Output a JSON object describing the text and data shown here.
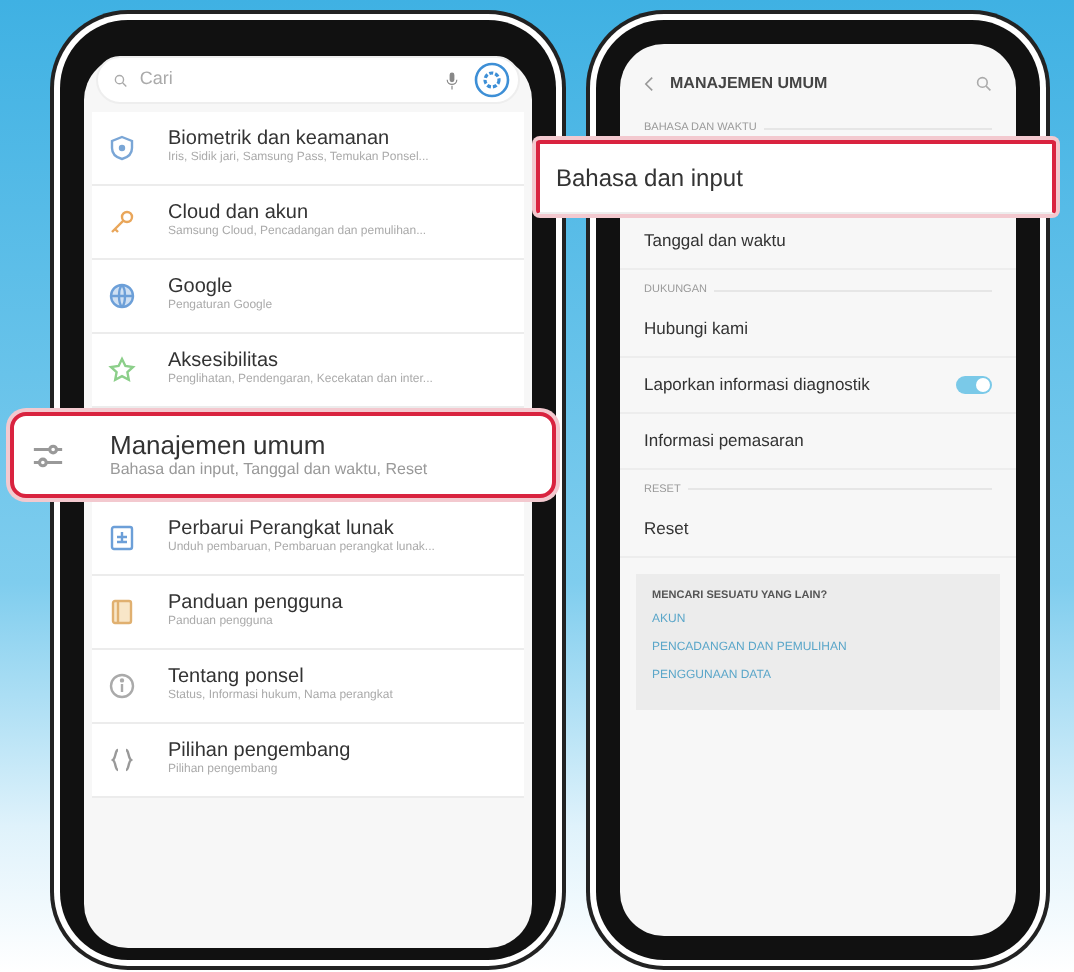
{
  "left_screen": {
    "search": {
      "placeholder": "Cari"
    },
    "items": [
      {
        "title": "Biometrik dan keamanan",
        "subtitle": "Iris, Sidik jari, Samsung Pass, Temukan Ponsel...",
        "highlighted": false
      },
      {
        "title": "Cloud dan akun",
        "subtitle": "Samsung Cloud, Pencadangan dan pemulihan...",
        "highlighted": false
      },
      {
        "title": "Google",
        "subtitle": "Pengaturan Google",
        "highlighted": false
      },
      {
        "title": "Aksesibilitas",
        "subtitle": "Penglihatan, Pendengaran, Kecekatan dan inter...",
        "highlighted": false
      },
      {
        "title": "Manajemen umum",
        "subtitle": "Bahasa dan input, Tanggal dan waktu, Reset",
        "highlighted": true
      },
      {
        "title": "Perbarui Perangkat lunak",
        "subtitle": "Unduh pembaruan, Pembaruan perangkat lunak...",
        "highlighted": false
      },
      {
        "title": "Panduan pengguna",
        "subtitle": "Panduan pengguna",
        "highlighted": false
      },
      {
        "title": "Tentang ponsel",
        "subtitle": "Status, Informasi hukum, Nama perangkat",
        "highlighted": false
      },
      {
        "title": "Pilihan pengembang",
        "subtitle": "Pilihan pengembang",
        "highlighted": false
      }
    ]
  },
  "right_screen": {
    "title": "MANAJEMEN UMUM",
    "sections": [
      {
        "header": "BAHASA DAN WAKTU",
        "items": [
          {
            "kind": "link",
            "label": "Bahasa dan input",
            "highlighted": true
          },
          {
            "kind": "link",
            "label": "Tanggal dan waktu",
            "highlighted": false
          }
        ]
      },
      {
        "header": "DUKUNGAN",
        "items": [
          {
            "kind": "link",
            "label": "Hubungi kami",
            "highlighted": false
          },
          {
            "kind": "switch",
            "label": "Laporkan informasi diagnostik",
            "on": true,
            "highlighted": false
          },
          {
            "kind": "link",
            "label": "Informasi pemasaran",
            "highlighted": false
          }
        ]
      },
      {
        "header": "RESET",
        "items": [
          {
            "kind": "link",
            "label": "Reset",
            "highlighted": false
          }
        ]
      }
    ],
    "suggestions": {
      "title": "MENCARI SESUATU YANG LAIN?",
      "links": [
        "AKUN",
        "PENCADANGAN DAN PEMULIHAN",
        "PENGGUNAAN DATA"
      ]
    }
  }
}
